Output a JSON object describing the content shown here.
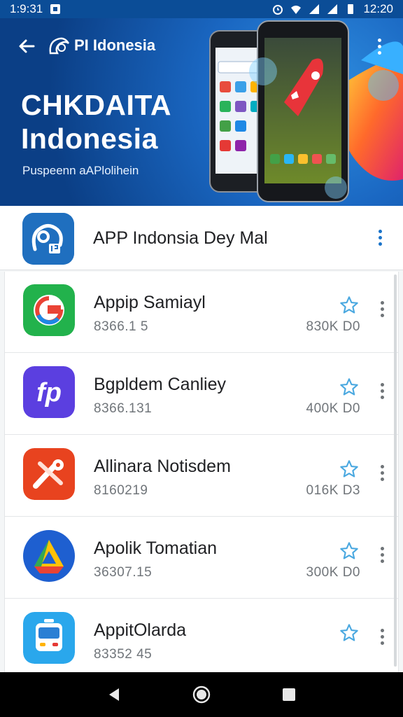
{
  "status_bar": {
    "time_left": "1:9:31",
    "time_right": "12:20"
  },
  "banner": {
    "brand": "PΙ Idonesia",
    "title_line1": "CHKDAITA",
    "title_line2": "Indonesia",
    "subtitle": "Puspeenn aAPlolihein"
  },
  "header": {
    "title": "APP Indonsia Dey Mal"
  },
  "apps": [
    {
      "name": "Appip Samiayl",
      "version": "8366.1 5",
      "size": "830K D0",
      "icon": "google-style-icon"
    },
    {
      "name": "Bgpldem Canliey",
      "version": "8366.131",
      "size": "400K D0",
      "icon": "fp-icon"
    },
    {
      "name": "Allinara Notisdem",
      "version": "8160219",
      "size": "016K D3",
      "icon": "tools-icon"
    },
    {
      "name": "Apolik Tomatian",
      "version": "36307.15",
      "size": "300K D0",
      "icon": "drive-icon"
    },
    {
      "name": "AppitOlarda",
      "version": "83352 45",
      "size": "",
      "icon": "transit-icon"
    }
  ],
  "colors": {
    "accent": "#1a73c9",
    "star": "#4aa8e0",
    "banner_dark": "#0b3f86"
  }
}
